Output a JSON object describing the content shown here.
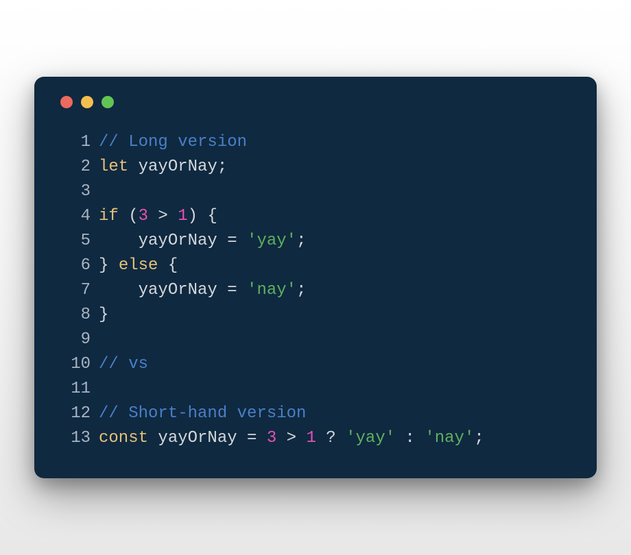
{
  "traffic_lights": {
    "red": "#ec6a5e",
    "yellow": "#f4bf4f",
    "green": "#61c554"
  },
  "code": {
    "lines": [
      {
        "num": "1",
        "tokens": [
          {
            "t": "// Long version",
            "c": "comment"
          }
        ]
      },
      {
        "num": "2",
        "tokens": [
          {
            "t": "let",
            "c": "keyword"
          },
          {
            "t": " yayOrNay",
            "c": "default"
          },
          {
            "t": ";",
            "c": "punct"
          }
        ]
      },
      {
        "num": "3",
        "tokens": []
      },
      {
        "num": "4",
        "tokens": [
          {
            "t": "if",
            "c": "keyword"
          },
          {
            "t": " (",
            "c": "punct"
          },
          {
            "t": "3",
            "c": "number"
          },
          {
            "t": " > ",
            "c": "operator"
          },
          {
            "t": "1",
            "c": "number"
          },
          {
            "t": ") {",
            "c": "punct"
          }
        ]
      },
      {
        "num": "5",
        "tokens": [
          {
            "t": "    yayOrNay ",
            "c": "default"
          },
          {
            "t": "=",
            "c": "operator"
          },
          {
            "t": " ",
            "c": "default"
          },
          {
            "t": "'yay'",
            "c": "string"
          },
          {
            "t": ";",
            "c": "punct"
          }
        ]
      },
      {
        "num": "6",
        "tokens": [
          {
            "t": "} ",
            "c": "punct"
          },
          {
            "t": "else",
            "c": "keyword"
          },
          {
            "t": " {",
            "c": "punct"
          }
        ]
      },
      {
        "num": "7",
        "tokens": [
          {
            "t": "    yayOrNay ",
            "c": "default"
          },
          {
            "t": "=",
            "c": "operator"
          },
          {
            "t": " ",
            "c": "default"
          },
          {
            "t": "'nay'",
            "c": "string"
          },
          {
            "t": ";",
            "c": "punct"
          }
        ]
      },
      {
        "num": "8",
        "tokens": [
          {
            "t": "}",
            "c": "punct"
          }
        ]
      },
      {
        "num": "9",
        "tokens": []
      },
      {
        "num": "10",
        "tokens": [
          {
            "t": "// vs",
            "c": "comment"
          }
        ]
      },
      {
        "num": "11",
        "tokens": []
      },
      {
        "num": "12",
        "tokens": [
          {
            "t": "// Short-hand version",
            "c": "comment"
          }
        ]
      },
      {
        "num": "13",
        "tokens": [
          {
            "t": "const",
            "c": "keyword"
          },
          {
            "t": " yayOrNay ",
            "c": "default"
          },
          {
            "t": "=",
            "c": "operator"
          },
          {
            "t": " ",
            "c": "default"
          },
          {
            "t": "3",
            "c": "number"
          },
          {
            "t": " > ",
            "c": "operator"
          },
          {
            "t": "1",
            "c": "number"
          },
          {
            "t": " ? ",
            "c": "operator"
          },
          {
            "t": "'yay'",
            "c": "string"
          },
          {
            "t": " : ",
            "c": "operator"
          },
          {
            "t": "'nay'",
            "c": "string"
          },
          {
            "t": ";",
            "c": "punct"
          }
        ]
      }
    ]
  }
}
